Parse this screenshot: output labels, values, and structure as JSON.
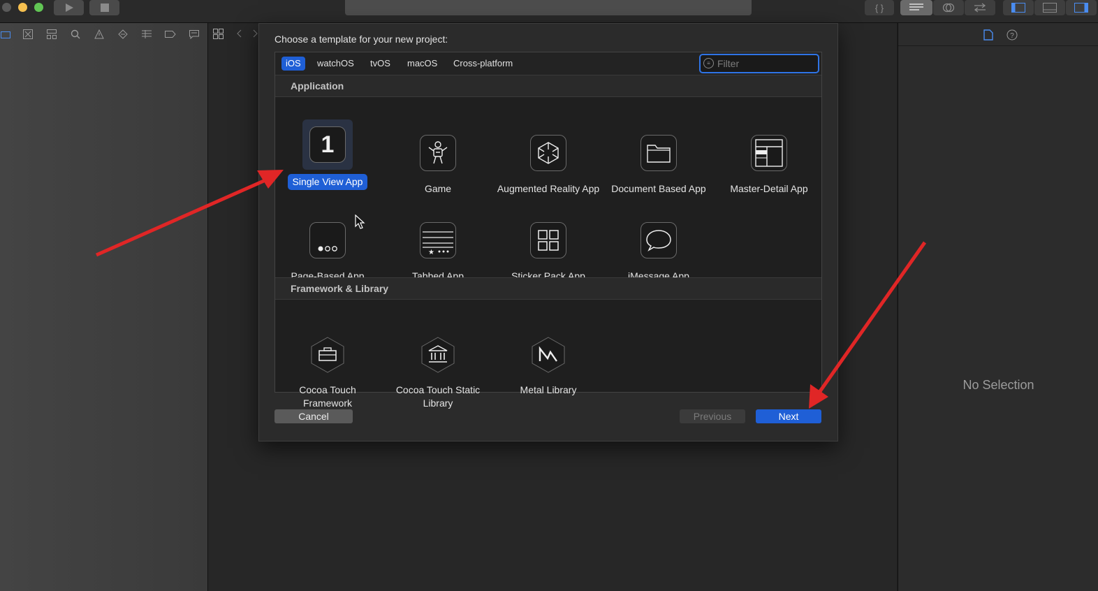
{
  "dialog": {
    "title": "Choose a template for your new project:",
    "tabs": [
      {
        "label": "iOS",
        "active": true
      },
      {
        "label": "watchOS"
      },
      {
        "label": "tvOS"
      },
      {
        "label": "macOS"
      },
      {
        "label": "Cross-platform"
      }
    ],
    "filter": {
      "placeholder": "Filter",
      "value": ""
    },
    "sections": {
      "application": {
        "title": "Application",
        "items": [
          {
            "label": "Single View App",
            "icon": "number-one-icon",
            "selected": true
          },
          {
            "label": "Game",
            "icon": "game-robot-icon"
          },
          {
            "label": "Augmented Reality App",
            "icon": "ar-cube-icon"
          },
          {
            "label": "Document Based App",
            "icon": "folder-icon"
          },
          {
            "label": "Master-Detail App",
            "icon": "master-detail-icon"
          },
          {
            "label": "Page-Based App",
            "icon": "page-dots-icon"
          },
          {
            "label": "Tabbed App",
            "icon": "tab-bar-icon"
          },
          {
            "label": "Sticker Pack App",
            "icon": "grid-icon"
          },
          {
            "label": "iMessage App",
            "icon": "speech-bubble-icon"
          }
        ]
      },
      "framework": {
        "title": "Framework & Library",
        "items": [
          {
            "label": "Cocoa Touch Framework",
            "icon": "toolbox-icon"
          },
          {
            "label": "Cocoa Touch Static Library",
            "icon": "library-building-icon"
          },
          {
            "label": "Metal Library",
            "icon": "metal-m-icon"
          }
        ]
      }
    },
    "buttons": {
      "cancel": "Cancel",
      "previous": "Previous",
      "next": "Next"
    }
  },
  "inspector": {
    "empty_text": "No Selection"
  },
  "colors": {
    "accent": "#1f5fd6",
    "annotation_arrow": "#e02626"
  }
}
